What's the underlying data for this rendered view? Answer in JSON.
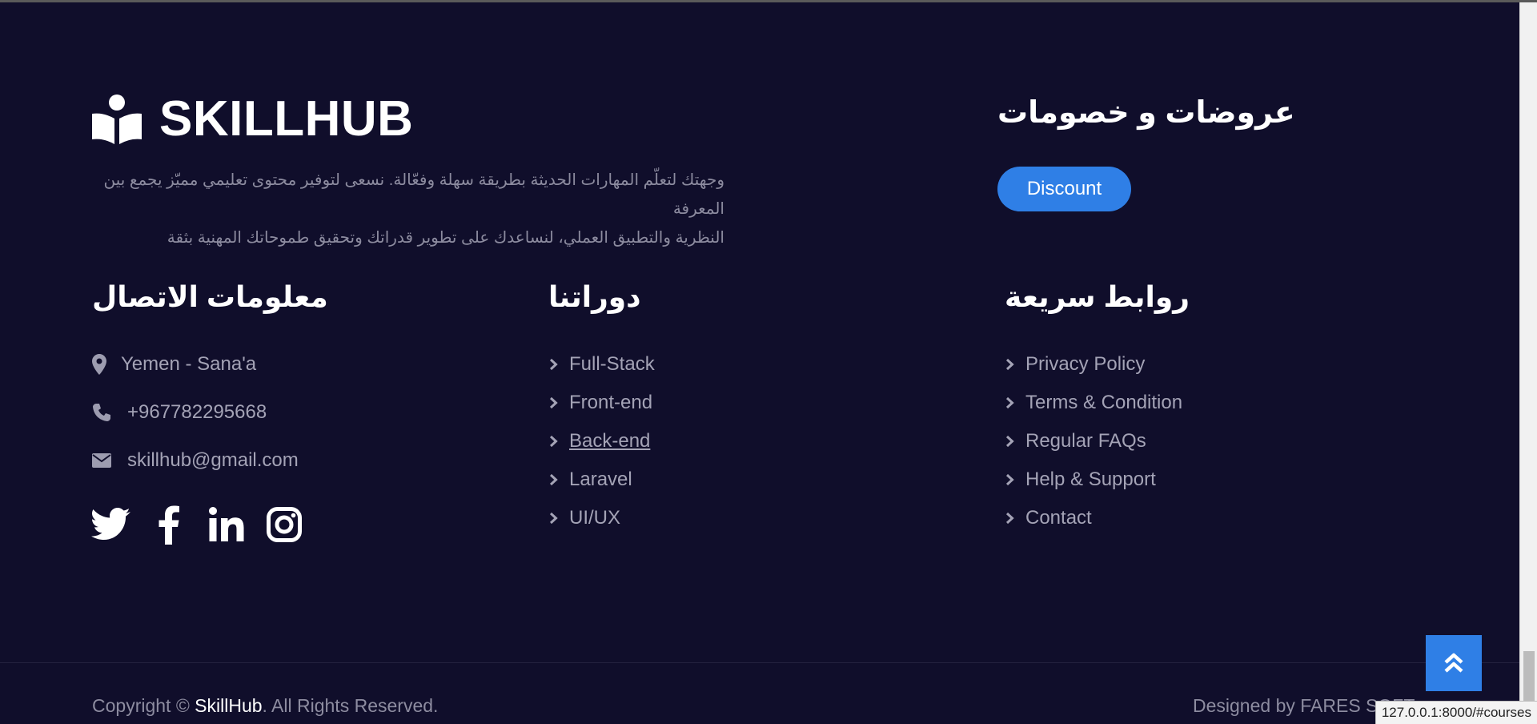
{
  "brand": {
    "name": "SKILLHUB",
    "icon": "book-reader-icon"
  },
  "about": {
    "line1": "وجهتك لتعلّم المهارات الحديثة بطريقة سهلة وفعّالة. نسعى لتوفير محتوى تعليمي مميّز يجمع بين المعرفة",
    "line2": "النظرية والتطبيق العملي، لنساعدك على تطوير قدراتك وتحقيق طموحاتك المهنية بثقة"
  },
  "offers": {
    "title": "عروضات و خصومات",
    "button_label": "Discount"
  },
  "contact": {
    "title": "معلومات الاتصال",
    "items": [
      {
        "icon": "map-marker-icon",
        "text": "Yemen - Sana'a"
      },
      {
        "icon": "phone-icon",
        "text": "+967782295668"
      },
      {
        "icon": "envelope-icon",
        "text": "skillhub@gmail.com"
      }
    ],
    "social": [
      "twitter-icon",
      "facebook-icon",
      "linkedin-icon",
      "instagram-icon"
    ]
  },
  "courses": {
    "title": "دوراتنا",
    "items": [
      "Full-Stack",
      "Front-end",
      "Back-end",
      "Laravel",
      "UI/UX"
    ]
  },
  "quick_links": {
    "title": "روابط سريعة",
    "items": [
      "Privacy Policy",
      "Terms & Condition",
      "Regular FAQs",
      "Help & Support",
      "Contact"
    ]
  },
  "footer": {
    "copyright_prefix": "Copyright © ",
    "copyright_brand": "SkillHub",
    "copyright_suffix": ". All Rights Reserved.",
    "designed_by": "Designed by FARES SOFT"
  },
  "status_bar": {
    "url": "127.0.0.1:8000/#courses"
  },
  "colors": {
    "background": "#100e2b",
    "accent": "#2f7fe6",
    "text_muted": "#a4a3b6",
    "heading": "#ffffff"
  }
}
